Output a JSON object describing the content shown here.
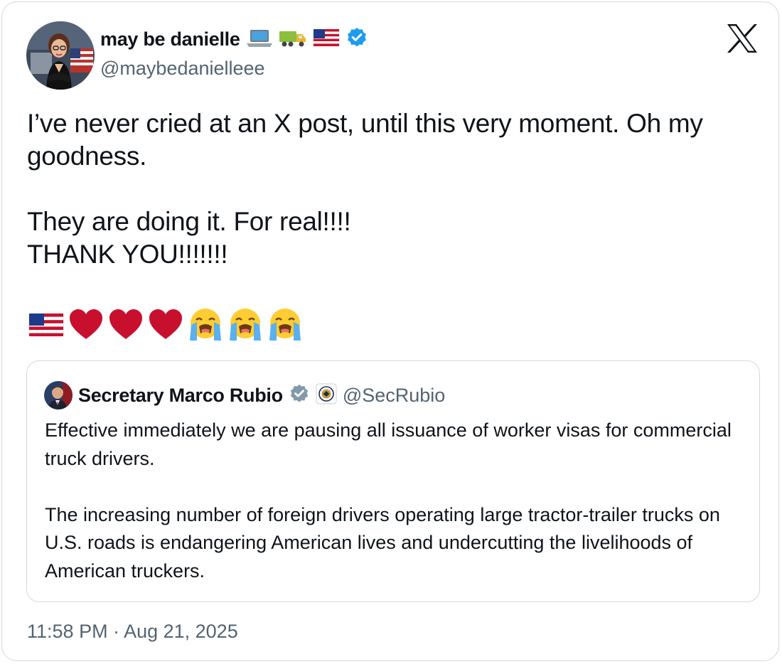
{
  "author": {
    "name": "may be danielle",
    "name_emojis": [
      "laptop-icon",
      "truck-icon",
      "us-flag-icon"
    ],
    "handle": "@maybedanielleee",
    "verified": true
  },
  "platform": {
    "logo": "x-logo-icon"
  },
  "tweet": {
    "line1": "I’ve never cried at an X post, until this very moment. Oh my goodness.",
    "line2": "They are doing it. For real!!!!",
    "line3": "THANK YOU!!!!!!!",
    "emojis": [
      "us-flag-icon",
      "red-heart-icon",
      "red-heart-icon",
      "red-heart-icon",
      "loudly-crying-face-icon",
      "loudly-crying-face-icon",
      "loudly-crying-face-icon"
    ]
  },
  "quote": {
    "name": "Secretary Marco Rubio",
    "verified": "gray-government-badge",
    "affiliation": "state-department-seal-icon",
    "handle": "@SecRubio",
    "paragraph1": "Effective immediately we are pausing all issuance of worker visas for commercial truck drivers.",
    "paragraph2": "The increasing number of foreign drivers operating large tractor-trailer trucks on U.S. roads is endangering American lives and undercutting the livelihoods of American truckers."
  },
  "timestamp": "11:58 PM · Aug 21, 2025",
  "colors": {
    "text": "#0f1419",
    "secondary": "#536471",
    "border": "#cfd9de",
    "verified_blue": "#1d9bf0",
    "verified_gray": "#829aab",
    "heart_red": "#c8102e"
  }
}
